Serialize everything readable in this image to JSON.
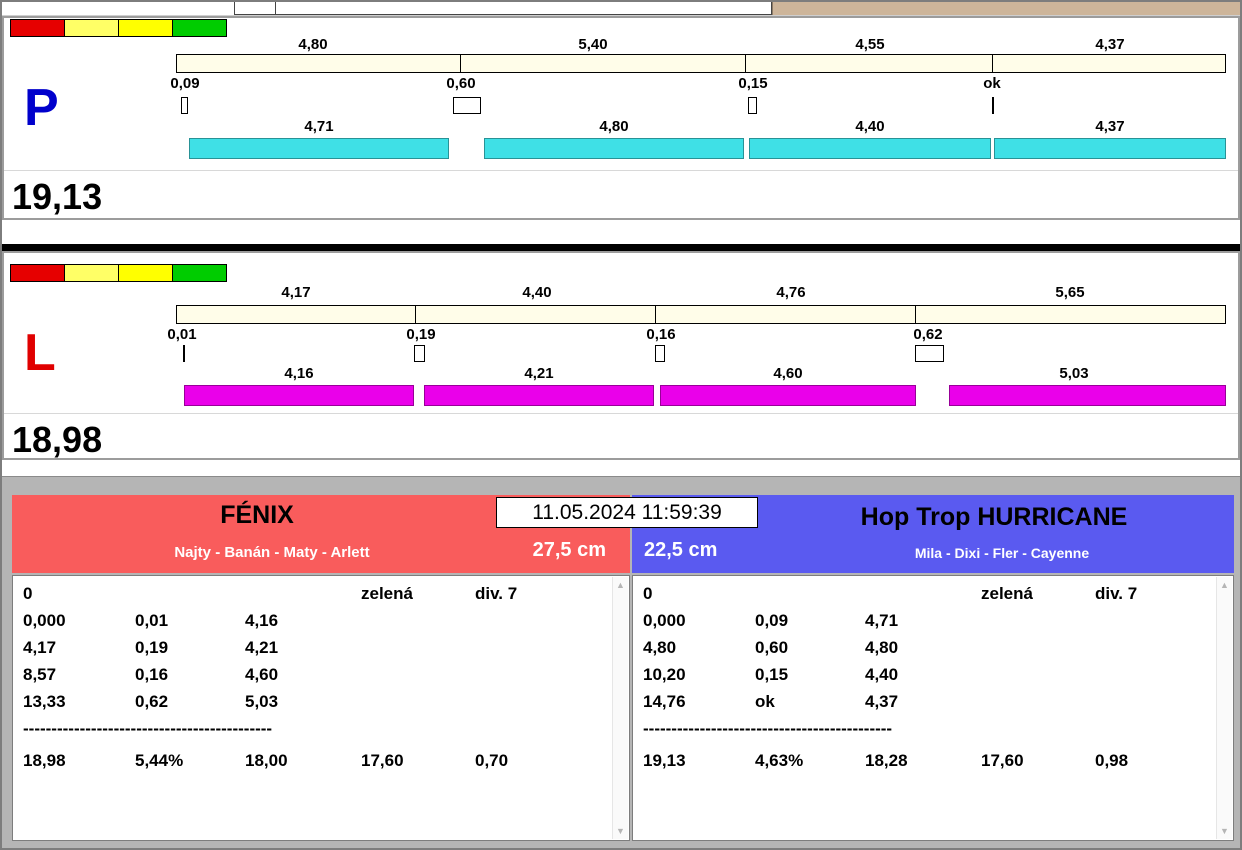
{
  "window": {
    "timestamp": "11.05.2024 11:59:39"
  },
  "lanes": {
    "p": {
      "letter": "P",
      "total": "19,13",
      "splits": [
        "4,80",
        "5,40",
        "4,55",
        "4,37"
      ],
      "changes": [
        "0,09",
        "0,60",
        "0,15",
        "ok"
      ],
      "runs": [
        "4,71",
        "4,80",
        "4,40",
        "4,37"
      ]
    },
    "l": {
      "letter": "L",
      "total": "18,98",
      "splits": [
        "4,17",
        "4,40",
        "4,76",
        "5,65"
      ],
      "changes": [
        "0,01",
        "0,19",
        "0,16",
        "0,62"
      ],
      "runs": [
        "4,16",
        "4,21",
        "4,60",
        "5,03"
      ]
    }
  },
  "left_team": {
    "name": "FÉNIX",
    "dogs": "Najty - Banán - Maty - Arlett",
    "jump_height": "27,5 cm",
    "table": {
      "penalty": "0",
      "light": "zelená",
      "division": "div. 7",
      "rows": [
        [
          "0,000",
          "0,01",
          "4,16"
        ],
        [
          "4,17",
          "0,19",
          "4,21"
        ],
        [
          "8,57",
          "0,16",
          "4,60"
        ],
        [
          "13,33",
          "0,62",
          "5,03"
        ]
      ],
      "separator": "--------------------------------------------",
      "summary": [
        "18,98",
        "5,44%",
        "18,00",
        "17,60",
        "0,70"
      ]
    }
  },
  "right_team": {
    "name": "Hop Trop HURRICANE",
    "dogs": "Mila - Dixi - Fler - Cayenne",
    "jump_height": "22,5 cm",
    "table": {
      "penalty": "0",
      "light": "zelená",
      "division": "div. 7",
      "rows": [
        [
          "0,000",
          "0,09",
          "4,71"
        ],
        [
          "4,80",
          "0,60",
          "4,80"
        ],
        [
          "10,20",
          "0,15",
          "4,40"
        ],
        [
          "14,76",
          "ok",
          "4,37"
        ]
      ],
      "separator": "--------------------------------------------",
      "summary": [
        "19,13",
        "4,63%",
        "18,28",
        "17,60",
        "0,98"
      ]
    }
  },
  "colors": {
    "lane_p_bar": "#3FE0E6",
    "lane_l_bar": "#EA00EA",
    "lane_p_letter": "#0000CC",
    "lane_l_letter": "#E00000",
    "left_header_bg": "#F95C5C",
    "right_header_bg": "#5A5AF0",
    "track_bg": "#FFFDE9",
    "status_lights": [
      "#E60000",
      "#FFFF66",
      "#FFFF00",
      "#00CC00"
    ],
    "titlebar_tan": "#CDB59A"
  }
}
